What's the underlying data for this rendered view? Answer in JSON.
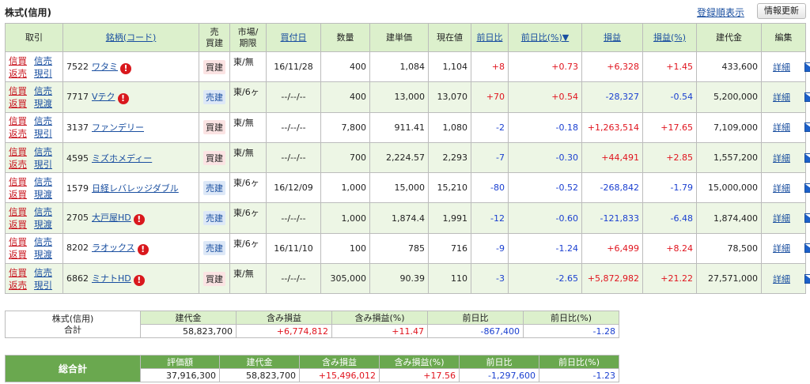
{
  "header": {
    "title": "株式(信用)",
    "sort_label": "登録順表示",
    "refresh_label": "情報更新"
  },
  "columns": {
    "trade": "取引",
    "name": "銘柄(コード)",
    "side": "売\n買建",
    "market": "市場/\n期限",
    "date": "買付日",
    "qty": "数量",
    "cost": "建単価",
    "price": "現在値",
    "chg": "前日比",
    "chgpct": "前日比(%)▼",
    "pl": "損益",
    "plpct": "損益(%)",
    "amount": "建代金",
    "edit": "編集"
  },
  "rows": [
    {
      "trade": [
        "信買",
        "信売",
        "返売",
        "現引"
      ],
      "code": "7522",
      "name": "ワタミ",
      "alert": true,
      "side": "買建",
      "side_type": "buy",
      "market": "東/無",
      "date": "16/11/28",
      "qty": "400",
      "cost": "1,084",
      "price": "1,104",
      "chg": "+8",
      "chgpct": "+0.73",
      "pl": "+6,328",
      "plpct": "+1.45",
      "amount": "433,600",
      "detail": "詳細"
    },
    {
      "trade": [
        "信買",
        "信売",
        "返買",
        "現渡"
      ],
      "code": "7717",
      "name": "Vテク",
      "alert": true,
      "side": "売建",
      "side_type": "sell",
      "market": "東/6ヶ",
      "date": "--/--/--",
      "qty": "400",
      "cost": "13,000",
      "price": "13,070",
      "chg": "+70",
      "chgpct": "+0.54",
      "pl": "-28,327",
      "plpct": "-0.54",
      "amount": "5,200,000",
      "detail": "詳細"
    },
    {
      "trade": [
        "信買",
        "信売",
        "返売",
        "現引"
      ],
      "code": "3137",
      "name": "ファンデリー",
      "alert": false,
      "side": "買建",
      "side_type": "buy",
      "market": "東/無",
      "date": "--/--/--",
      "qty": "7,800",
      "cost": "911.41",
      "price": "1,080",
      "chg": "-2",
      "chgpct": "-0.18",
      "pl": "+1,263,514",
      "plpct": "+17.65",
      "amount": "7,109,000",
      "detail": "詳細"
    },
    {
      "trade": [
        "信買",
        "信売",
        "返売",
        "現引"
      ],
      "code": "4595",
      "name": "ミズホメディー",
      "alert": false,
      "side": "買建",
      "side_type": "buy",
      "market": "東/無",
      "date": "--/--/--",
      "qty": "700",
      "cost": "2,224.57",
      "price": "2,293",
      "chg": "-7",
      "chgpct": "-0.30",
      "pl": "+44,491",
      "plpct": "+2.85",
      "amount": "1,557,200",
      "detail": "詳細"
    },
    {
      "trade": [
        "信買",
        "信売",
        "返買",
        "現渡"
      ],
      "code": "1579",
      "name": "日経レバレッジダブル",
      "alert": false,
      "side": "売建",
      "side_type": "sell",
      "market": "東/6ヶ",
      "date": "16/12/09",
      "qty": "1,000",
      "cost": "15,000",
      "price": "15,210",
      "chg": "-80",
      "chgpct": "-0.52",
      "pl": "-268,842",
      "plpct": "-1.79",
      "amount": "15,000,000",
      "detail": "詳細"
    },
    {
      "trade": [
        "信買",
        "信売",
        "返買",
        "現渡"
      ],
      "code": "2705",
      "name": "大戸屋HD",
      "alert": true,
      "side": "売建",
      "side_type": "sell",
      "market": "東/6ヶ",
      "date": "--/--/--",
      "qty": "1,000",
      "cost": "1,874.4",
      "price": "1,991",
      "chg": "-12",
      "chgpct": "-0.60",
      "pl": "-121,833",
      "plpct": "-6.48",
      "amount": "1,874,400",
      "detail": "詳細"
    },
    {
      "trade": [
        "信買",
        "信売",
        "返買",
        "現渡"
      ],
      "code": "8202",
      "name": "ラオックス",
      "alert": true,
      "side": "売建",
      "side_type": "sell",
      "market": "東/6ヶ",
      "date": "16/11/10",
      "qty": "100",
      "cost": "785",
      "price": "716",
      "chg": "-9",
      "chgpct": "-1.24",
      "pl": "+6,499",
      "plpct": "+8.24",
      "amount": "78,500",
      "detail": "詳細"
    },
    {
      "trade": [
        "信買",
        "信売",
        "返売",
        "現引"
      ],
      "code": "6862",
      "name": "ミナトHD",
      "alert": true,
      "side": "買建",
      "side_type": "buy",
      "market": "東/無",
      "date": "--/--/--",
      "qty": "305,000",
      "cost": "90.39",
      "price": "110",
      "chg": "-3",
      "chgpct": "-2.65",
      "pl": "+5,872,982",
      "plpct": "+21.22",
      "amount": "27,571,000",
      "detail": "詳細"
    }
  ],
  "subtotal": {
    "label1": "株式(信用)",
    "label2": "合計",
    "headers": [
      "建代金",
      "含み損益",
      "含み損益(%)",
      "前日比",
      "前日比(%)"
    ],
    "values": [
      "58,823,700",
      "+6,774,812",
      "+11.47",
      "-867,400",
      "-1.28"
    ]
  },
  "grandtotal": {
    "label": "総合計",
    "headers": [
      "評価額",
      "建代金",
      "含み損益",
      "含み損益(%)",
      "前日比",
      "前日比(%)"
    ],
    "values": [
      "37,916,300",
      "58,823,700",
      "+15,496,012",
      "+17.56",
      "-1,297,600",
      "-1.23"
    ]
  },
  "colors": {
    "header_bg": "#dcf0cc",
    "alt_row_bg": "#edf6e5",
    "grand_bg": "#6aa84f",
    "positive": "#e0141e",
    "negative": "#1a3fd0",
    "link": "#1a4fa0"
  }
}
